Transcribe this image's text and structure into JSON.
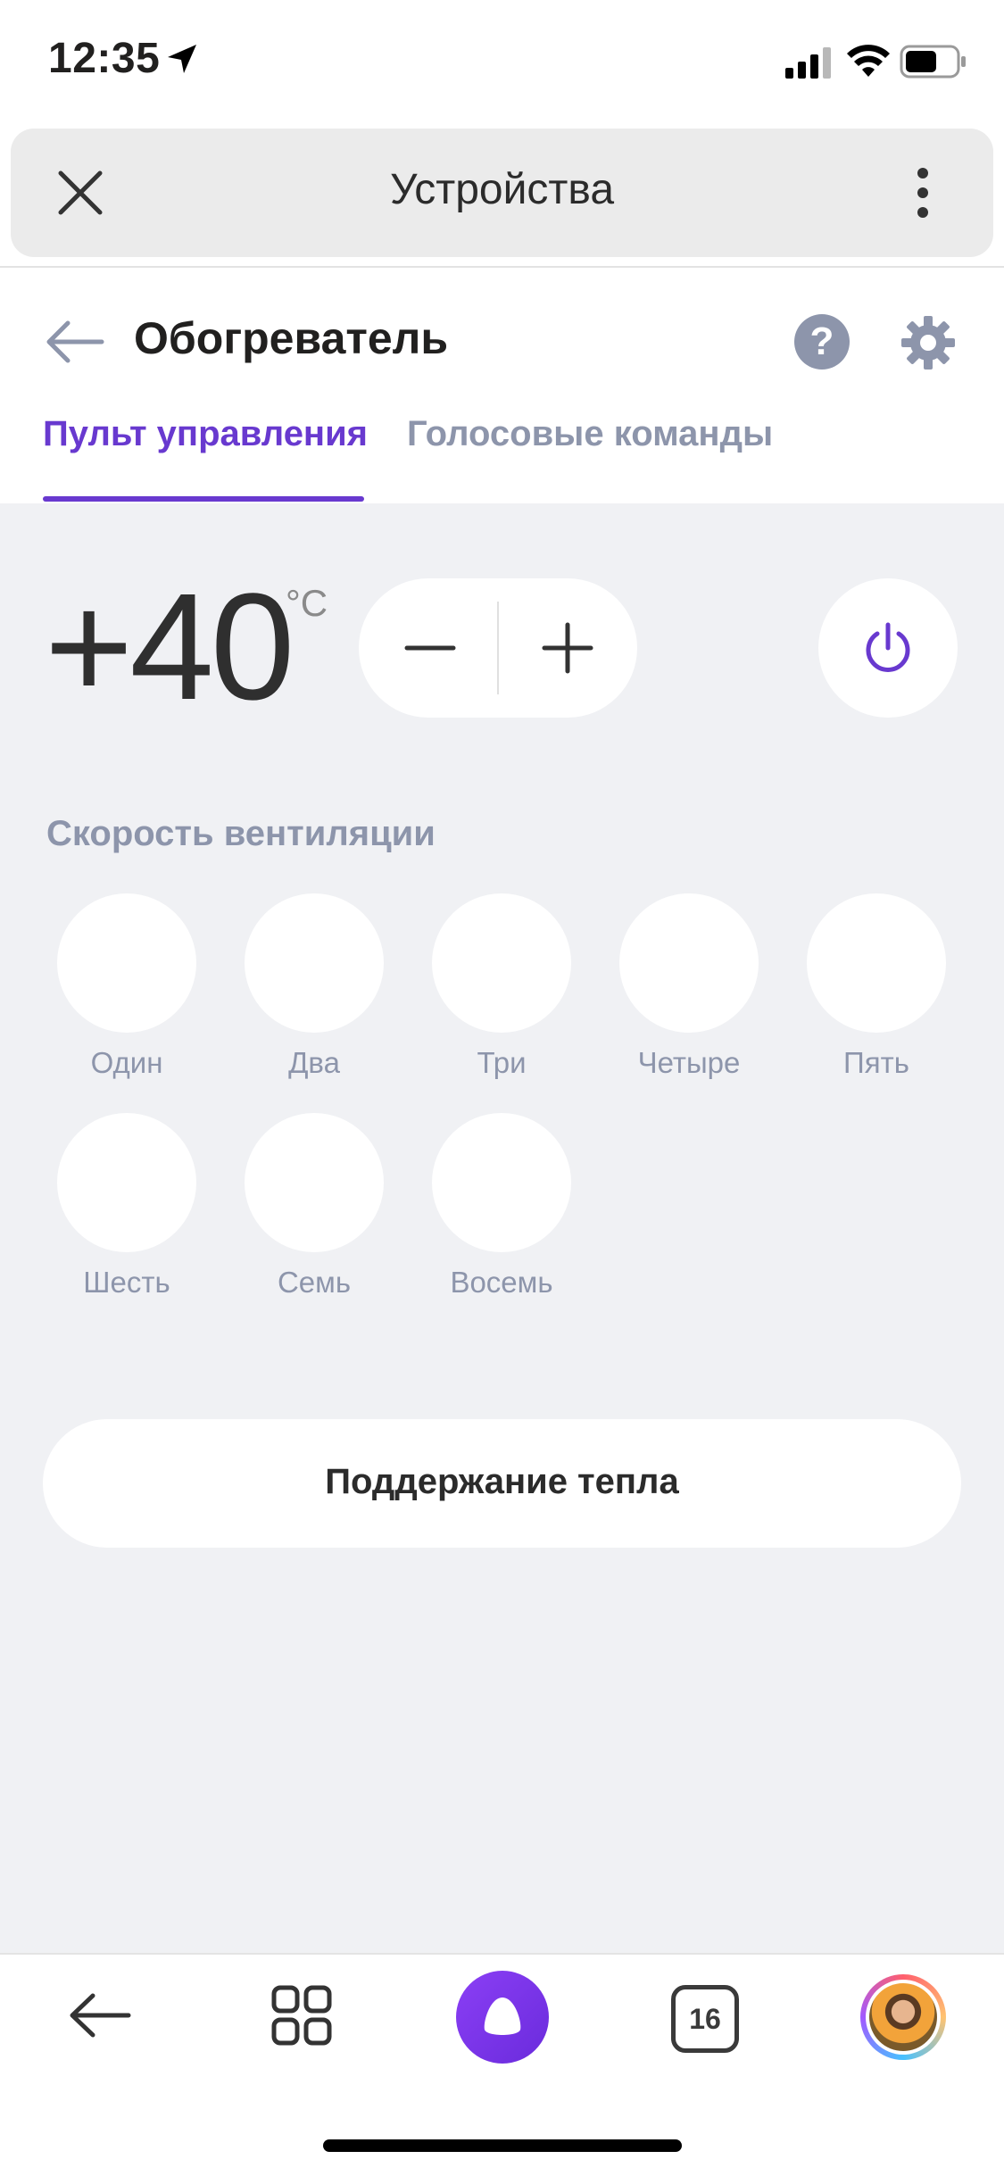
{
  "status_bar": {
    "time": "12:35",
    "icons": [
      "location-arrow-icon",
      "cellular-signal-icon",
      "wifi-icon",
      "battery-icon"
    ]
  },
  "top_bar": {
    "title": "Устройства",
    "close_icon": "close-icon",
    "menu_icon": "more-vertical-icon"
  },
  "device_header": {
    "title": "Обогреватель",
    "back_icon": "arrow-left-icon",
    "help_icon": "help-icon",
    "settings_icon": "gear-icon"
  },
  "tabs": [
    {
      "label": "Пульт управления",
      "active": true
    },
    {
      "label": "Голосовые команды",
      "active": false
    }
  ],
  "temperature": {
    "value": "+40",
    "unit": "°C",
    "minus_icon": "minus-icon",
    "plus_icon": "plus-icon",
    "power_icon": "power-icon"
  },
  "fan_speed": {
    "label": "Скорость вентиляции",
    "options": [
      "Один",
      "Два",
      "Три",
      "Четыре",
      "Пять",
      "Шесть",
      "Семь",
      "Восемь"
    ]
  },
  "mode_button": {
    "label": "Поддержание тепла"
  },
  "bottom_nav": {
    "items": [
      "back-arrow-icon",
      "services-grid-icon",
      "alice-assistant-icon",
      "tabs-counter-icon",
      "profile-avatar"
    ],
    "tabs_count": "16"
  },
  "colors": {
    "accent": "#6839cf",
    "secondary_text": "#8d95ab",
    "background": "#f0f1f4",
    "surface": "#ffffff"
  }
}
